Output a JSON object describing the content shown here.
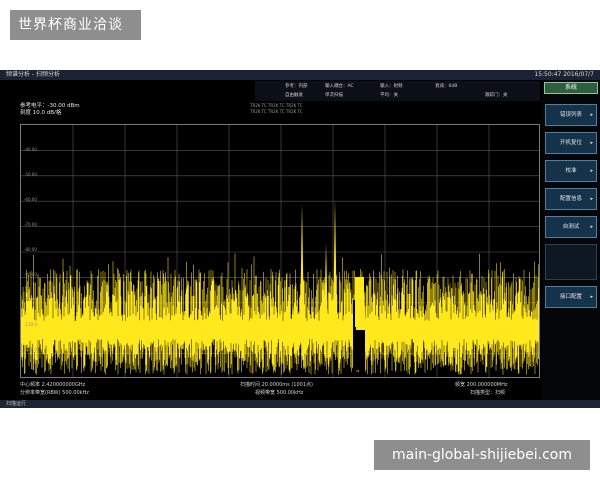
{
  "header": {
    "title": "世界杯商业洽谈"
  },
  "watermark": {
    "text": "main-global-shijiebei.com"
  },
  "device": {
    "app_title": "频谱分析 - 扫频分析",
    "clock": "15:50:47  2016/07/7",
    "status": {
      "item1": "参考：内部",
      "item2": "输入耦合：AC",
      "item3": "输入：射频",
      "item4": "衰减：0dB",
      "item5": "自由触发",
      "item6": "单次扫描",
      "item7": "平均：关",
      "item8": "跟踪门：关"
    },
    "ref_level": "参考电平：-30.00 dBm",
    "scale": "刻度 10.0 dB/格",
    "trace_legend_1": "TR2K  TC  TR2K  TC  TR2K  TC",
    "trace_legend_2": "TR2K  TC  TR2K  TC  TR2K  TC",
    "y_labels": [
      "-40.00",
      "-50.00",
      "-60.00",
      "-70.00",
      "-80.00",
      "-90.00",
      "-100.0",
      "-110.0",
      "-120.0"
    ],
    "footer": {
      "center_freq": "中心频率 2.420000000GHz",
      "rbw": "分辨率带宽(RBW) 500.00kHz",
      "sweep_time": "扫描时间 20.0000ms (1001点)",
      "vbw": "视频带宽 500.00kHz",
      "span": "频宽 200.000000MHz",
      "sweep_type": "扫描类型：扫频"
    },
    "bottom_status": "扫描运行"
  },
  "menu": {
    "title": "系统",
    "items": [
      "错误列表",
      "开机复位",
      "校准",
      "配置信息",
      "自测试",
      "",
      "接口配置"
    ]
  },
  "colors": {
    "trace": "#ffe81c",
    "grid": "#5a5a5a",
    "menu_button": "#14324a"
  }
}
